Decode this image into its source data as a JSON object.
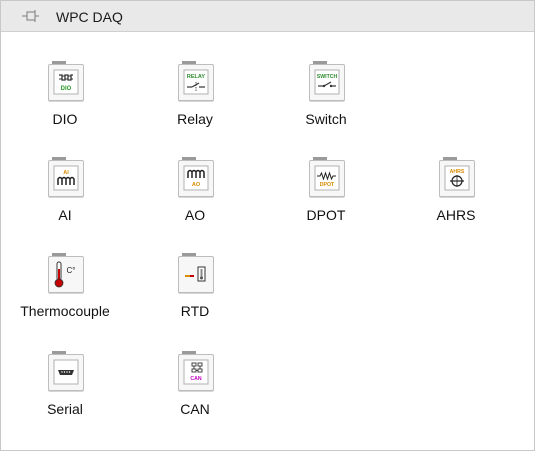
{
  "panel": {
    "title": "WPC DAQ",
    "pin_icon": "pin-icon"
  },
  "tiles": [
    {
      "label": "DIO",
      "icon": "dio-icon",
      "icon_text_top": "",
      "icon_text_bottom": "DIO"
    },
    {
      "label": "Relay",
      "icon": "relay-icon",
      "icon_text_top": "RELAY",
      "icon_text_bottom": ""
    },
    {
      "label": "Switch",
      "icon": "switch-icon",
      "icon_text_top": "SWITCH",
      "icon_text_bottom": ""
    },
    {
      "label": "AI",
      "icon": "ai-icon",
      "icon_text_top": "AI",
      "icon_text_bottom": ""
    },
    {
      "label": "AO",
      "icon": "ao-icon",
      "icon_text_top": "",
      "icon_text_bottom": "AO"
    },
    {
      "label": "DPOT",
      "icon": "dpot-icon",
      "icon_text_top": "",
      "icon_text_bottom": "DPOT"
    },
    {
      "label": "AHRS",
      "icon": "ahrs-icon",
      "icon_text_top": "AHRS",
      "icon_text_bottom": ""
    },
    {
      "label": "Thermocouple",
      "icon": "thermocouple-icon",
      "icon_text_top": "C°",
      "icon_text_bottom": ""
    },
    {
      "label": "RTD",
      "icon": "rtd-icon",
      "icon_text_top": "",
      "icon_text_bottom": ""
    },
    {
      "label": "Serial",
      "icon": "serial-icon",
      "icon_text_top": "",
      "icon_text_bottom": ""
    },
    {
      "label": "CAN",
      "icon": "can-icon",
      "icon_text_top": "",
      "icon_text_bottom": "CAN"
    }
  ],
  "colors": {
    "dio": "#2b9b2b",
    "relay": "#2e8b2e",
    "ai": "#d88a00",
    "ao": "#d88a00",
    "dpot": "#d88a00",
    "ahrs": "#d88a00",
    "thermo": "#c40000",
    "can": "#c000c0"
  }
}
